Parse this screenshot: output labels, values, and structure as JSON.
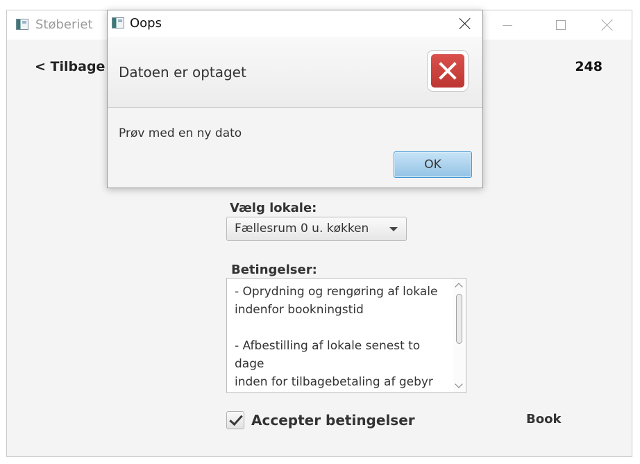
{
  "main_window": {
    "title": "Støberiet",
    "back_label": "< Tilbage",
    "count": "248",
    "venue_label": "Vælg lokale:",
    "venue_selected": "Fællesrum 0 u. køkken",
    "terms_label": "Betingelser:",
    "terms_lines": [
      "- Oprydning og rengøring af lokale",
      "indenfor bookningstid",
      "",
      "- Afbestilling af lokale senest to dage",
      "inden for tilbagebetaling af gebyr"
    ],
    "accept_label": "Accepter betingelser",
    "accept_checked": true,
    "book_label": "Book"
  },
  "dialog": {
    "title": "Oops",
    "header": "Datoen er optaget",
    "content": "Prøv med en ny dato",
    "ok_label": "OK",
    "icon": "error-icon"
  }
}
